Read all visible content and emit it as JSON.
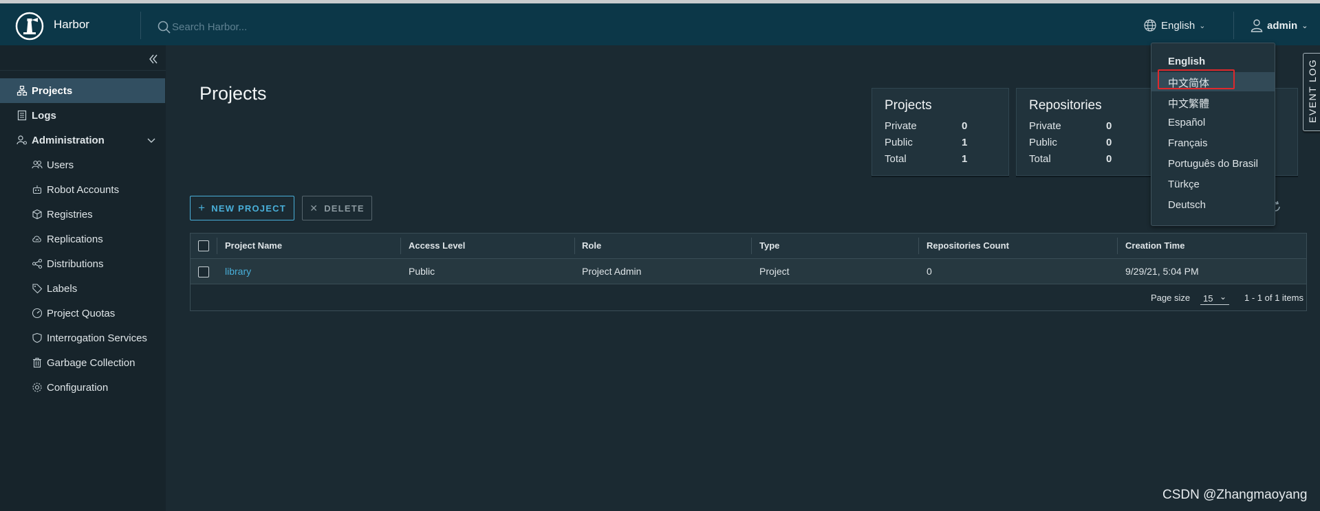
{
  "header": {
    "brand": "Harbor",
    "search_placeholder": "Search Harbor...",
    "language": "English",
    "user": "admin"
  },
  "sidebar": {
    "items": [
      {
        "label": "Projects"
      },
      {
        "label": "Logs"
      },
      {
        "label": "Administration"
      },
      {
        "label": "Users"
      },
      {
        "label": "Robot Accounts"
      },
      {
        "label": "Registries"
      },
      {
        "label": "Replications"
      },
      {
        "label": "Distributions"
      },
      {
        "label": "Labels"
      },
      {
        "label": "Project Quotas"
      },
      {
        "label": "Interrogation Services"
      },
      {
        "label": "Garbage Collection"
      },
      {
        "label": "Configuration"
      }
    ]
  },
  "main": {
    "title": "Projects",
    "cards": [
      {
        "title": "Projects",
        "rows": [
          {
            "label": "Private",
            "value": "0"
          },
          {
            "label": "Public",
            "value": "1"
          },
          {
            "label": "Total",
            "value": "1"
          }
        ]
      },
      {
        "title": "Repositories",
        "rows": [
          {
            "label": "Private",
            "value": "0"
          },
          {
            "label": "Public",
            "value": "0"
          },
          {
            "label": "Total",
            "value": "0"
          }
        ]
      }
    ],
    "new_project": "NEW PROJECT",
    "delete": "DELETE",
    "table": {
      "headers": [
        "Project Name",
        "Access Level",
        "Role",
        "Type",
        "Repositories Count",
        "Creation Time"
      ],
      "rows": [
        [
          "library",
          "Public",
          "Project Admin",
          "Project",
          "0",
          "9/29/21, 5:04 PM"
        ]
      ],
      "page_size_label": "Page size",
      "page_size": "15",
      "count": "1 - 1 of 1 items"
    }
  },
  "language_menu": {
    "options": [
      "English",
      "中文简体",
      "中文繁體",
      "Español",
      "Français",
      "Português do Brasil",
      "Türkçe",
      "Deutsch"
    ],
    "selected": "English",
    "highlighted": "中文简体"
  },
  "event_log": "EVENT LOG",
  "watermark": "CSDN @Zhangmaoyang",
  "colors": {
    "header_bg": "#0c3748",
    "sidebar_bg": "#17242b",
    "content_bg": "#1b2a32",
    "accent": "#49afd9",
    "active_nav": "#324f61",
    "highlight_red": "#e0282c"
  }
}
